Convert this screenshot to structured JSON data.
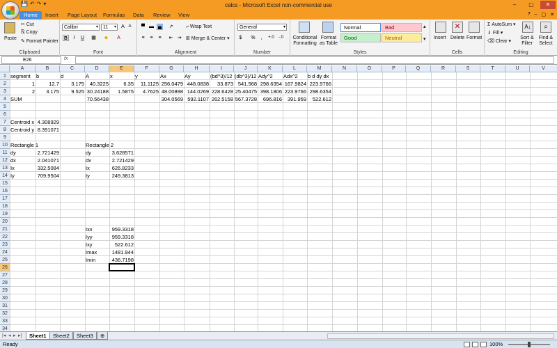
{
  "window": {
    "title": "calcs - Microsoft Excel non-commercial use",
    "qat": [
      "💾",
      "↶",
      "↷",
      "▾"
    ]
  },
  "tabs": [
    {
      "label": "Home",
      "active": true
    },
    {
      "label": "Insert"
    },
    {
      "label": "Page Layout"
    },
    {
      "label": "Formulas"
    },
    {
      "label": "Data"
    },
    {
      "label": "Review"
    },
    {
      "label": "View"
    }
  ],
  "ribbon": {
    "clipboard": {
      "label": "Clipboard",
      "paste": "Paste",
      "cut": "Cut",
      "copy": "Copy",
      "format_painter": "Format Painter"
    },
    "font": {
      "label": "Font",
      "name": "Calibri",
      "size": "11",
      "bold": "B",
      "italic": "I",
      "underline": "U"
    },
    "alignment": {
      "label": "Alignment",
      "wrap": "Wrap Text",
      "merge": "Merge & Center"
    },
    "number": {
      "label": "Number",
      "format": "General",
      "currency": "$",
      "percent": "%",
      "comma": ","
    },
    "styles": {
      "label": "Styles",
      "conditional": "Conditional Formatting",
      "table": "Format as Table",
      "cells": [
        {
          "name": "Normal",
          "bg": "#ffffff",
          "fg": "#000000"
        },
        {
          "name": "Bad",
          "bg": "#ffc7ce",
          "fg": "#9c0006"
        },
        {
          "name": "Good",
          "bg": "#c6efce",
          "fg": "#006100"
        },
        {
          "name": "Neutral",
          "bg": "#ffeb9c",
          "fg": "#9c6500"
        }
      ]
    },
    "cells": {
      "label": "Cells",
      "insert": "Insert",
      "delete": "Delete",
      "format": "Format"
    },
    "editing": {
      "label": "Editing",
      "autosum": "AutoSum",
      "fill": "Fill",
      "clear": "Clear",
      "sort": "Sort & Filter",
      "find": "Find & Select"
    }
  },
  "formula_bar": {
    "name_box": "E26",
    "fx": "fx",
    "content": ""
  },
  "columns": [
    "A",
    "B",
    "C",
    "D",
    "E",
    "F",
    "G",
    "H",
    "I",
    "J",
    "K",
    "L",
    "M",
    "N",
    "O",
    "P",
    "Q",
    "R",
    "S",
    "T",
    "U",
    "V"
  ],
  "rows": [
    "1",
    "2",
    "3",
    "4",
    "5",
    "6",
    "7",
    "8",
    "9",
    "10",
    "11",
    "12",
    "13",
    "14",
    "15",
    "16",
    "17",
    "18",
    "19",
    "20",
    "21",
    "22",
    "23",
    "24",
    "25",
    "26",
    "27",
    "28",
    "29",
    "30",
    "31",
    "32",
    "33",
    "34"
  ],
  "cells": [
    {
      "r": 0,
      "c": 0,
      "v": "segment"
    },
    {
      "r": 0,
      "c": 1,
      "v": "b"
    },
    {
      "r": 0,
      "c": 2,
      "v": "d"
    },
    {
      "r": 0,
      "c": 3,
      "v": "A"
    },
    {
      "r": 0,
      "c": 4,
      "v": "x"
    },
    {
      "r": 0,
      "c": 5,
      "v": "y"
    },
    {
      "r": 0,
      "c": 6,
      "v": "Ax"
    },
    {
      "r": 0,
      "c": 7,
      "v": "Ay"
    },
    {
      "r": 0,
      "c": 8,
      "v": "(bd^3)/12"
    },
    {
      "r": 0,
      "c": 9,
      "v": "(db^3)/12"
    },
    {
      "r": 0,
      "c": 10,
      "v": "Ady^2"
    },
    {
      "r": 0,
      "c": 11,
      "v": "Adx^2"
    },
    {
      "r": 0,
      "c": 12,
      "v": "b d dy dx"
    },
    {
      "r": 1,
      "c": 0,
      "v": "1",
      "n": true
    },
    {
      "r": 1,
      "c": 1,
      "v": "12.7",
      "n": true
    },
    {
      "r": 1,
      "c": 2,
      "v": "3.175",
      "n": true
    },
    {
      "r": 1,
      "c": 3,
      "v": "40.3225",
      "n": true
    },
    {
      "r": 1,
      "c": 4,
      "v": "6.35",
      "n": true
    },
    {
      "r": 1,
      "c": 5,
      "v": "11.1125",
      "n": true
    },
    {
      "r": 1,
      "c": 6,
      "v": "256.0479",
      "n": true
    },
    {
      "r": 1,
      "c": 7,
      "v": "448.0838",
      "n": true
    },
    {
      "r": 1,
      "c": 8,
      "v": "33.873",
      "n": true
    },
    {
      "r": 1,
      "c": 9,
      "v": "541.968",
      "n": true
    },
    {
      "r": 1,
      "c": 10,
      "v": "298.6354",
      "n": true
    },
    {
      "r": 1,
      "c": 11,
      "v": "167.9824",
      "n": true
    },
    {
      "r": 1,
      "c": 12,
      "v": "223.9766",
      "n": true
    },
    {
      "r": 2,
      "c": 0,
      "v": "2",
      "n": true
    },
    {
      "r": 2,
      "c": 1,
      "v": "3.175",
      "n": true
    },
    {
      "r": 2,
      "c": 2,
      "v": "9.525",
      "n": true
    },
    {
      "r": 2,
      "c": 3,
      "v": "30.24188",
      "n": true
    },
    {
      "r": 2,
      "c": 4,
      "v": "1.5875",
      "n": true
    },
    {
      "r": 2,
      "c": 5,
      "v": "4.7625",
      "n": true
    },
    {
      "r": 2,
      "c": 6,
      "v": "48.00898",
      "n": true
    },
    {
      "r": 2,
      "c": 7,
      "v": "144.0269",
      "n": true
    },
    {
      "r": 2,
      "c": 8,
      "v": "228.6428",
      "n": true
    },
    {
      "r": 2,
      "c": 9,
      "v": "25.40475",
      "n": true
    },
    {
      "r": 2,
      "c": 10,
      "v": "398.1806",
      "n": true
    },
    {
      "r": 2,
      "c": 11,
      "v": "223.9766",
      "n": true
    },
    {
      "r": 2,
      "c": 12,
      "v": "298.6354",
      "n": true
    },
    {
      "r": 3,
      "c": 0,
      "v": "SUM"
    },
    {
      "r": 3,
      "c": 3,
      "v": "70.56438",
      "n": true
    },
    {
      "r": 3,
      "c": 6,
      "v": "304.0569",
      "n": true
    },
    {
      "r": 3,
      "c": 7,
      "v": "592.1107",
      "n": true
    },
    {
      "r": 3,
      "c": 8,
      "v": "262.5158",
      "n": true
    },
    {
      "r": 3,
      "c": 9,
      "v": "567.3728",
      "n": true
    },
    {
      "r": 3,
      "c": 10,
      "v": "696.816",
      "n": true
    },
    {
      "r": 3,
      "c": 11,
      "v": "391.959",
      "n": true
    },
    {
      "r": 3,
      "c": 12,
      "v": "522.612",
      "n": true
    },
    {
      "r": 6,
      "c": 0,
      "v": "Centroid x"
    },
    {
      "r": 6,
      "c": 1,
      "v": "4.308929",
      "n": true
    },
    {
      "r": 7,
      "c": 0,
      "v": "Centroid y"
    },
    {
      "r": 7,
      "c": 1,
      "v": "8.391071",
      "n": true
    },
    {
      "r": 9,
      "c": 0,
      "v": "Rectangle 1"
    },
    {
      "r": 9,
      "c": 3,
      "v": "Rectangle 2"
    },
    {
      "r": 10,
      "c": 0,
      "v": "dy"
    },
    {
      "r": 10,
      "c": 1,
      "v": "2.721429",
      "n": true
    },
    {
      "r": 10,
      "c": 3,
      "v": "dy"
    },
    {
      "r": 10,
      "c": 4,
      "v": "3.628571",
      "n": true
    },
    {
      "r": 11,
      "c": 0,
      "v": "dx"
    },
    {
      "r": 11,
      "c": 1,
      "v": "2.041071",
      "n": true
    },
    {
      "r": 11,
      "c": 3,
      "v": "dx"
    },
    {
      "r": 11,
      "c": 4,
      "v": "2.721429",
      "n": true
    },
    {
      "r": 12,
      "c": 0,
      "v": "Ix"
    },
    {
      "r": 12,
      "c": 1,
      "v": "332.5084",
      "n": true
    },
    {
      "r": 12,
      "c": 3,
      "v": "Ix"
    },
    {
      "r": 12,
      "c": 4,
      "v": "626.8233",
      "n": true
    },
    {
      "r": 13,
      "c": 0,
      "v": "Iy"
    },
    {
      "r": 13,
      "c": 1,
      "v": "709.9504",
      "n": true
    },
    {
      "r": 13,
      "c": 3,
      "v": "Iy"
    },
    {
      "r": 13,
      "c": 4,
      "v": "249.3813",
      "n": true
    },
    {
      "r": 20,
      "c": 3,
      "v": "Ixx"
    },
    {
      "r": 20,
      "c": 4,
      "v": "959.3318",
      "n": true
    },
    {
      "r": 21,
      "c": 3,
      "v": "Iyy"
    },
    {
      "r": 21,
      "c": 4,
      "v": "959.3318",
      "n": true
    },
    {
      "r": 22,
      "c": 3,
      "v": "Ixy"
    },
    {
      "r": 22,
      "c": 4,
      "v": "522.612",
      "n": true
    },
    {
      "r": 23,
      "c": 3,
      "v": "Imax"
    },
    {
      "r": 23,
      "c": 4,
      "v": "1481.944",
      "n": true
    },
    {
      "r": 24,
      "c": 3,
      "v": "Imin"
    },
    {
      "r": 24,
      "c": 4,
      "v": "436.7198",
      "n": true
    }
  ],
  "active_cell": {
    "r": 25,
    "c": 4
  },
  "sheets": [
    {
      "name": "Sheet1",
      "active": true
    },
    {
      "name": "Sheet2"
    },
    {
      "name": "Sheet3"
    }
  ],
  "status": {
    "text": "Ready",
    "zoom": "100%"
  }
}
